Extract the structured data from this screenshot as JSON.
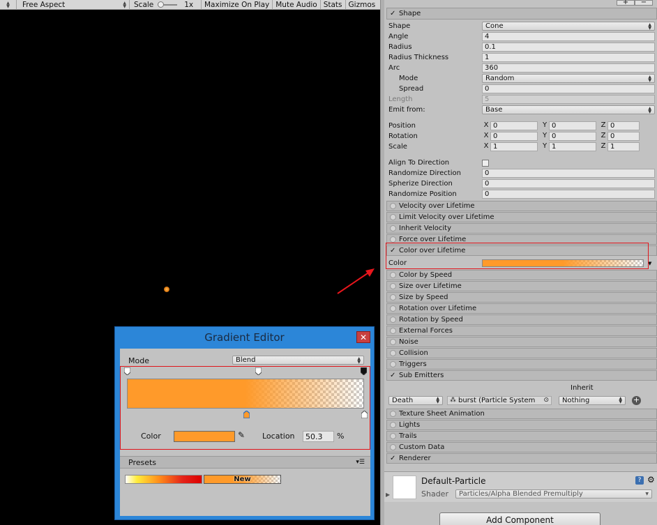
{
  "game_toolbar": {
    "aspect": "Free Aspect",
    "scale_label": "Scale",
    "scale_value": "1x",
    "maximize": "Maximize On Play",
    "mute": "Mute Audio",
    "stats": "Stats",
    "gizmos": "Gizmos"
  },
  "inspector": {
    "shape_module": {
      "title": "Shape",
      "rows": {
        "shape": {
          "label": "Shape",
          "value": "Cone"
        },
        "angle": {
          "label": "Angle",
          "value": "4"
        },
        "radius": {
          "label": "Radius",
          "value": "0.1"
        },
        "radius_thickness": {
          "label": "Radius Thickness",
          "value": "1"
        },
        "arc": {
          "label": "Arc",
          "value": "360"
        },
        "mode": {
          "label": "Mode",
          "value": "Random"
        },
        "spread": {
          "label": "Spread",
          "value": "0"
        },
        "length": {
          "label": "Length",
          "value": "5"
        },
        "emit_from": {
          "label": "Emit from:",
          "value": "Base"
        },
        "position": {
          "label": "Position",
          "x": "0",
          "y": "0",
          "z": "0"
        },
        "rotation": {
          "label": "Rotation",
          "x": "0",
          "y": "0",
          "z": "0"
        },
        "scale": {
          "label": "Scale",
          "x": "1",
          "y": "1",
          "z": "1"
        },
        "align_to_direction": {
          "label": "Align To Direction"
        },
        "randomize_direction": {
          "label": "Randomize Direction",
          "value": "0"
        },
        "spherize_direction": {
          "label": "Spherize Direction",
          "value": "0"
        },
        "randomize_position": {
          "label": "Randomize Position",
          "value": "0"
        }
      },
      "axis_labels": {
        "x": "X",
        "y": "Y",
        "z": "Z"
      }
    },
    "modules": {
      "velocity": "Velocity over Lifetime",
      "limit_velocity": "Limit Velocity over Lifetime",
      "inherit_velocity": "Inherit Velocity",
      "force": "Force over Lifetime",
      "color_over_lifetime": "Color over Lifetime",
      "color_label": "Color",
      "color_by_speed": "Color by Speed",
      "size_over_lifetime": "Size over Lifetime",
      "size_by_speed": "Size by Speed",
      "rotation_over_lifetime": "Rotation over Lifetime",
      "rotation_by_speed": "Rotation by Speed",
      "external_forces": "External Forces",
      "noise": "Noise",
      "collision": "Collision",
      "triggers": "Triggers",
      "sub_emitters": "Sub Emitters",
      "texture_sheet": "Texture Sheet Animation",
      "lights": "Lights",
      "trails": "Trails",
      "custom_data": "Custom Data",
      "renderer": "Renderer"
    },
    "sub_emitter_row": {
      "inherit_header": "Inherit",
      "event": "Death",
      "system": "burst (Particle System",
      "inherit": "Nothing"
    },
    "material": {
      "name": "Default-Particle",
      "shader_label": "Shader",
      "shader_value": "Particles/Alpha Blended Premultiply"
    },
    "add_component": "Add Component"
  },
  "gradient_editor": {
    "title": "Gradient Editor",
    "mode_label": "Mode",
    "mode_value": "Blend",
    "color_label": "Color",
    "location_label": "Location",
    "location_value": "50.3",
    "percent": "%",
    "presets_label": "Presets",
    "preset_new": "New",
    "gradient_color": "#ff9a2a"
  },
  "colors": {
    "orange": "#ff9a2a",
    "highlight_red": "#e0151b",
    "arrow_red": "#e8161c"
  }
}
